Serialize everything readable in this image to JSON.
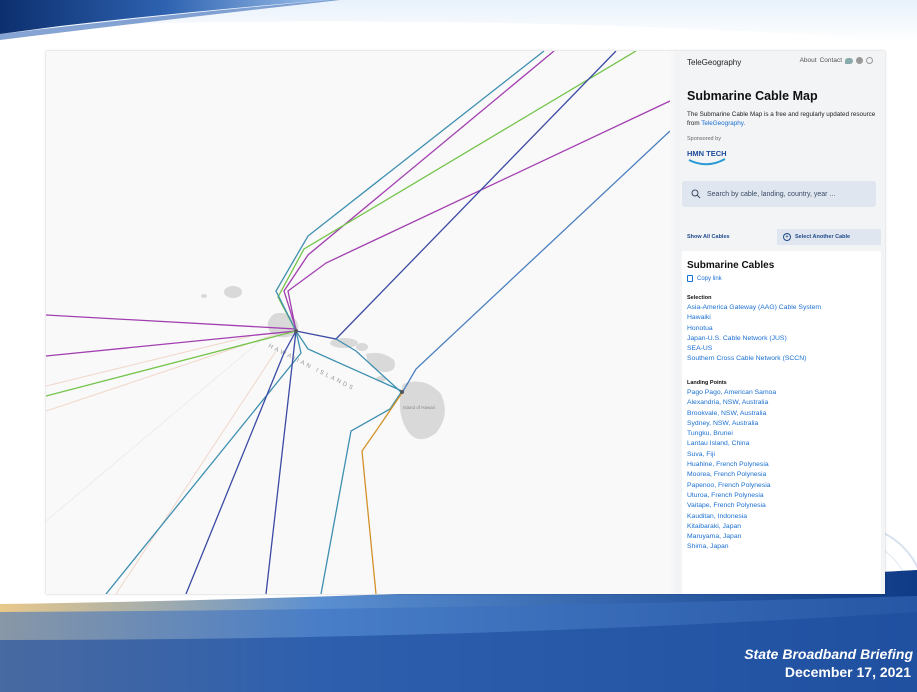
{
  "slide": {
    "footer_title": "State Broadband Briefing",
    "footer_date": "December 17, 2021"
  },
  "map": {
    "labels": {
      "islands": "HAWAIIAN ISLANDS",
      "big_island": "Island of Hawaii"
    },
    "cable_colors": {
      "purple": "#a23fb0",
      "green": "#74c44a",
      "teal": "#3e8fb0",
      "navy": "#3b4aa3",
      "blue": "#4a7ec0",
      "orange": "#d2922a"
    }
  },
  "panel": {
    "brand": "TeleGeography",
    "links": {
      "about": "About",
      "contact": "Contact"
    },
    "icons": [
      "twitter-icon",
      "github-icon",
      "globe-icon"
    ],
    "title": "Submarine Cable Map",
    "description": "The Submarine Cable Map is a free and regularly updated resource from ",
    "description_link": "TeleGeography.",
    "sponsored_label": "Sponsored by",
    "sponsor_name": "HMN TECH",
    "search_placeholder": "Search by cable, landing, country, year ...",
    "tabs": {
      "show_all": "Show All Cables",
      "select_another": "Select Another Cable"
    },
    "section_title": "Submarine Cables",
    "copy_link": "Copy link",
    "selection_heading": "Selection",
    "selection": [
      "Asia-America Gateway (AAG) Cable System",
      "Hawaiki",
      "Honotua",
      "Japan-U.S. Cable Network (JUS)",
      "SEA-US",
      "Southern Cross Cable Network (SCCN)"
    ],
    "landing_heading": "Landing Points",
    "landing_points": [
      "Pago Pago, American Samoa",
      "Alexandria, NSW, Australia",
      "Brookvale, NSW, Australia",
      "Sydney, NSW, Australia",
      "Tungku, Brunei",
      "Lantau Island, China",
      "Suva, Fiji",
      "Huahine, French Polynesia",
      "Moorea, French Polynesia",
      "Papenoo, French Polynesia",
      "Uturoa, French Polynesia",
      "Vaitape, French Polynesia",
      "Kauditan, Indonesia",
      "Kitaibaraki, Japan",
      "Maruyama, Japan",
      "Shima, Japan"
    ]
  }
}
